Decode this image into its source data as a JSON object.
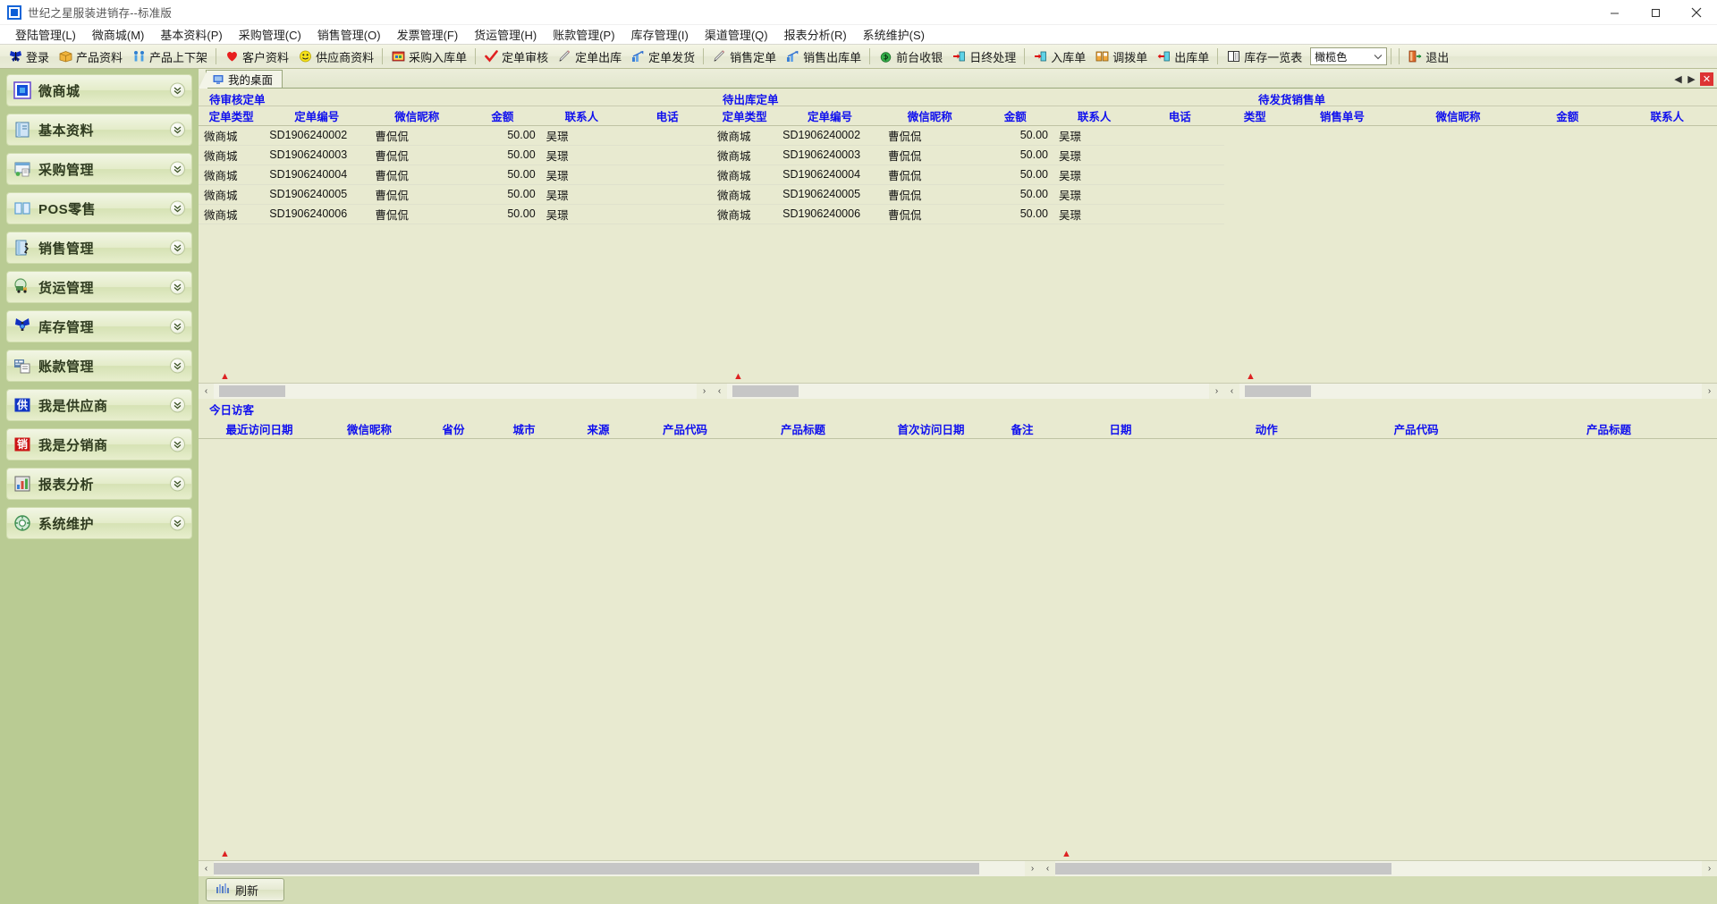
{
  "window": {
    "title": "世纪之星服装进销存--标准版",
    "app_icon": "app-square-icon",
    "minimize": "—",
    "maximize": "▢",
    "close": "✕"
  },
  "menubar": {
    "items": [
      {
        "label": "登陆管理(L)"
      },
      {
        "label": "微商城(M)"
      },
      {
        "label": "基本资料(P)"
      },
      {
        "label": "采购管理(C)"
      },
      {
        "label": "销售管理(O)"
      },
      {
        "label": "发票管理(F)"
      },
      {
        "label": "货运管理(H)"
      },
      {
        "label": "账款管理(P)"
      },
      {
        "label": "库存管理(I)"
      },
      {
        "label": "渠道管理(Q)"
      },
      {
        "label": "报表分析(R)"
      },
      {
        "label": "系统维护(S)"
      }
    ]
  },
  "toolbar": {
    "items": [
      {
        "label": "登录",
        "icon": "butterfly-icon"
      },
      {
        "label": "产品资料",
        "icon": "box-icon"
      },
      {
        "label": "产品上下架",
        "icon": "shelf-icon"
      },
      {
        "sep": true
      },
      {
        "label": "客户资料",
        "icon": "heart-icon"
      },
      {
        "label": "供应商资料",
        "icon": "smiley-icon"
      },
      {
        "sep": true
      },
      {
        "label": "采购入库单",
        "icon": "purchase-icon"
      },
      {
        "sep": true
      },
      {
        "label": "定单审核",
        "icon": "check-icon"
      },
      {
        "label": "定单出库",
        "icon": "pen-icon"
      },
      {
        "label": "定单发货",
        "icon": "chart-icon"
      },
      {
        "sep": true
      },
      {
        "label": "销售定单",
        "icon": "pen-icon"
      },
      {
        "label": "销售出库单",
        "icon": "chart-icon"
      },
      {
        "sep": true
      },
      {
        "label": "前台收银",
        "icon": "cash-icon"
      },
      {
        "label": "日终处理",
        "icon": "door-in-icon"
      },
      {
        "sep": true
      },
      {
        "label": "入库单",
        "icon": "door-in-icon"
      },
      {
        "label": "调拨单",
        "icon": "transfer-icon"
      },
      {
        "label": "出库单",
        "icon": "door-out-icon"
      },
      {
        "sep": true
      },
      {
        "label": "库存一览表",
        "icon": "book-icon"
      }
    ],
    "theme_combo": {
      "value": "橄榄色",
      "icon": "chevron-down-icon"
    },
    "exit": {
      "label": "退出",
      "icon": "exit-icon"
    }
  },
  "sidebar": {
    "items": [
      {
        "label": "微商城",
        "icon": "square-blue-icon"
      },
      {
        "label": "基本资料",
        "icon": "document-icon"
      },
      {
        "label": "采购管理",
        "icon": "purchase-window-icon"
      },
      {
        "label": "POS零售",
        "icon": "pos-icon"
      },
      {
        "label": "销售管理",
        "icon": "sales-door-icon"
      },
      {
        "label": "货运管理",
        "icon": "truck-icon"
      },
      {
        "label": "库存管理",
        "icon": "warehouse-icon"
      },
      {
        "label": "账款管理",
        "icon": "account-icon"
      },
      {
        "label": "我是供应商",
        "icon": "supplier-icon"
      },
      {
        "label": "我是分销商",
        "icon": "distributor-icon"
      },
      {
        "label": "报表分析",
        "icon": "report-icon"
      },
      {
        "label": "系统维护",
        "icon": "system-icon"
      }
    ],
    "chevron": "chevron-double-down-icon"
  },
  "tabs": {
    "active": {
      "label": "我的桌面",
      "icon": "desktop-icon"
    },
    "nav": {
      "prev": "◀",
      "next": "▶",
      "close": "✕"
    }
  },
  "panels": {
    "pending_review": {
      "title": "待审核定单",
      "columns": [
        "定单类型",
        "定单编号",
        "微信昵称",
        "金额",
        "联系人",
        "电话"
      ],
      "rows": [
        {
          "type": "微商城",
          "no": "SD1906240002",
          "nick": "曹侃侃",
          "amount": "50.00",
          "contact": "吴璟",
          "phone": ""
        },
        {
          "type": "微商城",
          "no": "SD1906240003",
          "nick": "曹侃侃",
          "amount": "50.00",
          "contact": "吴璟",
          "phone": ""
        },
        {
          "type": "微商城",
          "no": "SD1906240004",
          "nick": "曹侃侃",
          "amount": "50.00",
          "contact": "吴璟",
          "phone": ""
        },
        {
          "type": "微商城",
          "no": "SD1906240005",
          "nick": "曹侃侃",
          "amount": "50.00",
          "contact": "吴璟",
          "phone": ""
        },
        {
          "type": "微商城",
          "no": "SD1906240006",
          "nick": "曹侃侃",
          "amount": "50.00",
          "contact": "吴璟",
          "phone": ""
        }
      ]
    },
    "pending_outbound": {
      "title": "待出库定单",
      "columns": [
        "定单类型",
        "定单编号",
        "微信昵称",
        "金额",
        "联系人",
        "电话"
      ],
      "rows": [
        {
          "type": "微商城",
          "no": "SD1906240002",
          "nick": "曹侃侃",
          "amount": "50.00",
          "contact": "吴璟",
          "phone": ""
        },
        {
          "type": "微商城",
          "no": "SD1906240003",
          "nick": "曹侃侃",
          "amount": "50.00",
          "contact": "吴璟",
          "phone": ""
        },
        {
          "type": "微商城",
          "no": "SD1906240004",
          "nick": "曹侃侃",
          "amount": "50.00",
          "contact": "吴璟",
          "phone": ""
        },
        {
          "type": "微商城",
          "no": "SD1906240005",
          "nick": "曹侃侃",
          "amount": "50.00",
          "contact": "吴璟",
          "phone": ""
        },
        {
          "type": "微商城",
          "no": "SD1906240006",
          "nick": "曹侃侃",
          "amount": "50.00",
          "contact": "吴璟",
          "phone": ""
        }
      ]
    },
    "pending_shipment": {
      "title": "待发货销售单",
      "columns": [
        "类型",
        "销售单号",
        "微信昵称",
        "金额",
        "联系人"
      ],
      "rows": []
    },
    "today_visitors": {
      "title": "今日访客",
      "columns_left": [
        "最近访问日期",
        "微信昵称",
        "省份",
        "城市",
        "来源",
        "产品代码",
        "产品标题",
        "首次访问日期",
        "备注"
      ],
      "columns_right": [
        "日期",
        "动作",
        "产品代码",
        "产品标题"
      ],
      "rows_left": [],
      "rows_right": []
    }
  },
  "statusbar": {
    "refresh": {
      "label": "刷新",
      "icon": "refresh-icon"
    }
  },
  "colors": {
    "accent_blue": "#1010ee",
    "sidebar_bg": "#b9cb93",
    "panel_bg": "#e8ead0",
    "toolbar_bg": "#eceedb"
  },
  "scroll": {
    "left_arrow": "‹",
    "right_arrow": "›",
    "warn": "⚠"
  }
}
